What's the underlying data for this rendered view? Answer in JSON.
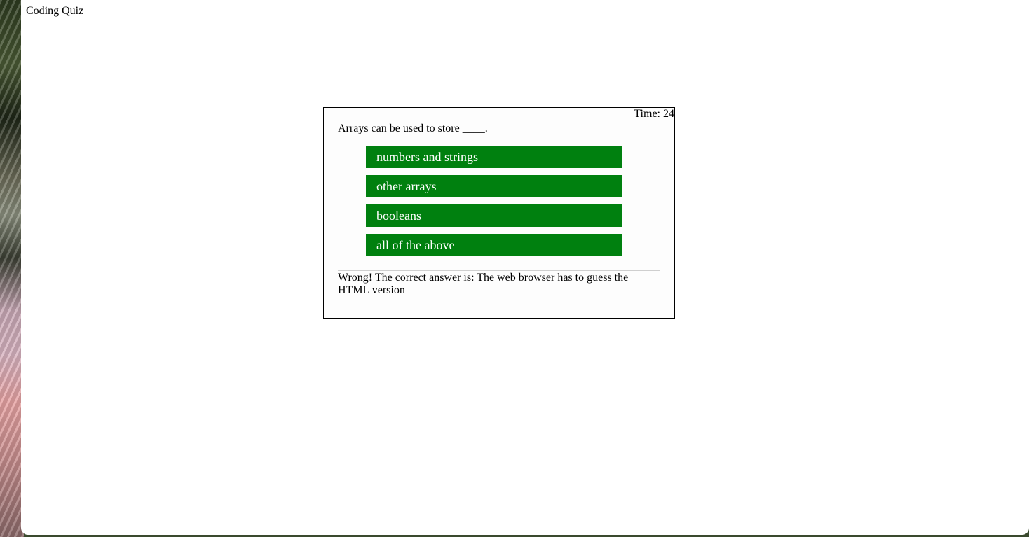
{
  "page": {
    "title": "Coding Quiz"
  },
  "quiz": {
    "timer": "Time: 24",
    "question": "Arrays can be used to store ____.",
    "choices": [
      "numbers and strings",
      "other arrays",
      "booleans",
      "all of the above"
    ],
    "feedback": "Wrong! The correct answer is: The web browser has to guess the HTML version"
  },
  "colors": {
    "choice_background": "#00800f",
    "choice_text": "#ffffff",
    "card_border": "#000000",
    "divider": "#cfcfcf"
  }
}
